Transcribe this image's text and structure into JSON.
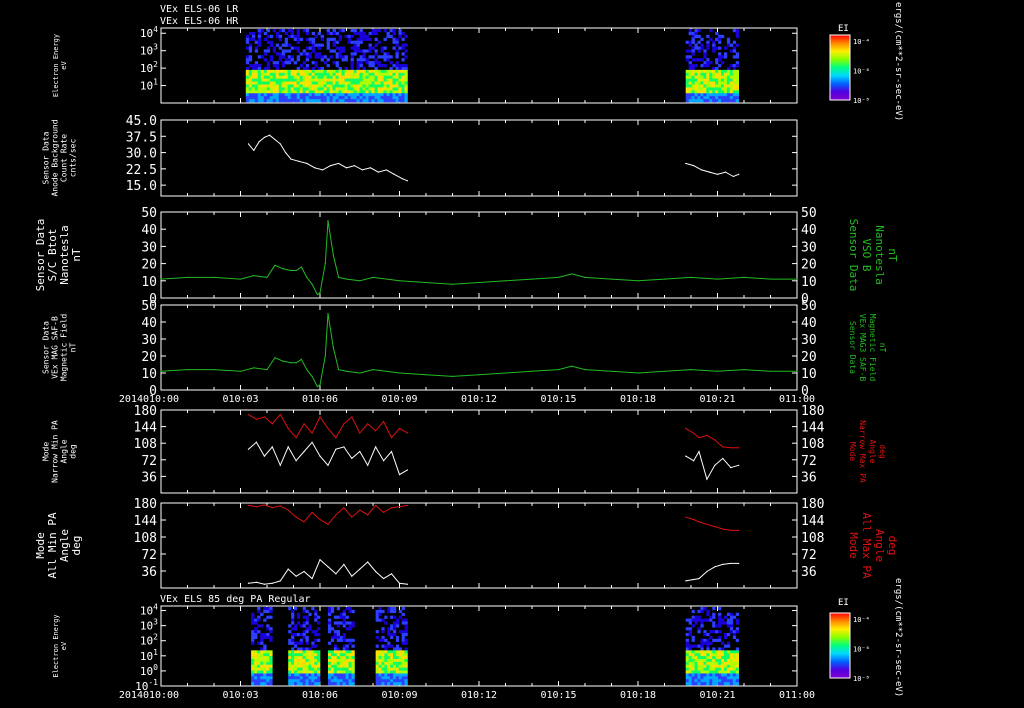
{
  "colors": {
    "background": "#000000",
    "axis": "#ffffff",
    "bfield": "#22bb22",
    "max_pa": "#dd1111",
    "min_pa": "#ffffff"
  },
  "time_axis": {
    "year": "2014",
    "start": "010:00",
    "end": "011:00",
    "ticks": [
      "010:00",
      "010:03",
      "010:06",
      "010:09",
      "010:12",
      "010:15",
      "010:18",
      "010:21",
      "011:00"
    ]
  },
  "chart_data": [
    {
      "type": "heatmap",
      "title": "VEx ELS-06 LR",
      "subtitle": "VEx ELS-06 HR",
      "ylabel": [
        "Electron Energy",
        "eV"
      ],
      "yscale": "log",
      "ylim": [
        1,
        20000
      ],
      "yticks": [
        {
          "v": 10,
          "label": "10",
          "sup": "1"
        },
        {
          "v": 100,
          "label": "10",
          "sup": "2"
        },
        {
          "v": 1000,
          "label": "10",
          "sup": "3"
        },
        {
          "v": 10000,
          "label": "10",
          "sup": "4"
        }
      ],
      "colorbar": {
        "title": "EI",
        "labels": [
          "10⁻⁴",
          "10⁻⁶",
          "10⁻⁸"
        ],
        "unit": "ergs/(cm**2-sr-sec-eV)"
      },
      "data_windows": [
        [
          3.2,
          9.3
        ],
        [
          19.8,
          21.8
        ]
      ]
    },
    {
      "type": "line",
      "ylabel": [
        "Sensor Data",
        "Anode Background",
        "Count Rate",
        "cnts/sec"
      ],
      "ylim": [
        10,
        45
      ],
      "yticks": [
        "15.0",
        "22.5",
        "30.0",
        "37.5",
        "45.0"
      ],
      "ytick_values": [
        15,
        22.5,
        30,
        37.5,
        45
      ],
      "series": [
        {
          "color": "#ffffff",
          "x": [
            3.3,
            3.5,
            3.7,
            3.9,
            4.1,
            4.3,
            4.5,
            4.7,
            4.9,
            5.2,
            5.5,
            5.8,
            6.1,
            6.4,
            6.7,
            7.0,
            7.3,
            7.6,
            7.9,
            8.2,
            8.5,
            8.8,
            9.1,
            9.3
          ],
          "y": [
            34,
            31,
            35,
            37,
            38,
            36,
            34,
            30,
            27,
            26,
            25,
            23,
            22,
            24,
            25,
            23,
            24,
            22,
            23,
            21,
            22,
            20,
            18,
            17
          ]
        },
        {
          "color": "#ffffff",
          "x": [
            19.8,
            20.1,
            20.4,
            20.7,
            21.0,
            21.3,
            21.6,
            21.8
          ],
          "y": [
            25,
            24,
            22,
            21,
            20,
            21,
            19,
            20
          ]
        }
      ]
    },
    {
      "type": "line",
      "ylabel": [
        "Sensor Data",
        "S/C Btot",
        "Nanotesla",
        "nT"
      ],
      "right_label": [
        "Sensor Data",
        "VSO B",
        "Nanotesla",
        "nT"
      ],
      "ylim": [
        0,
        50
      ],
      "yticks": [
        "0",
        "10",
        "20",
        "30",
        "40",
        "50"
      ],
      "ytick_values": [
        0,
        10,
        20,
        30,
        40,
        50
      ],
      "series": [
        {
          "color": "#22bb22",
          "x": [
            0,
            1,
            2,
            3,
            3.5,
            4.0,
            4.3,
            4.6,
            4.9,
            5.1,
            5.3,
            5.5,
            5.7,
            5.9,
            6.0,
            6.2,
            6.3,
            6.5,
            6.7,
            7,
            7.5,
            8,
            9,
            10,
            11,
            12,
            13,
            14,
            15,
            15.5,
            16,
            17,
            18,
            19,
            20,
            21,
            22,
            23,
            24
          ],
          "y": [
            11,
            12,
            12,
            11,
            13,
            12,
            19,
            17,
            16,
            16,
            18,
            12,
            8,
            2,
            3,
            20,
            45,
            25,
            12,
            11,
            10,
            12,
            10,
            9,
            8,
            9,
            10,
            11,
            12,
            14,
            12,
            11,
            10,
            11,
            12,
            11,
            12,
            11,
            11
          ]
        }
      ]
    },
    {
      "type": "line",
      "ylabel": [
        "Sensor Data",
        "VEx MAG SAF-B",
        "Magnetic Field",
        "nT"
      ],
      "right_label": [
        "Sensor Data",
        "VEx MAG3 SAF-B",
        "Magnetic Field",
        "nT"
      ],
      "ylim": [
        0,
        50
      ],
      "yticks": [
        "0",
        "10",
        "20",
        "30",
        "40",
        "50"
      ],
      "ytick_values": [
        0,
        10,
        20,
        30,
        40,
        50
      ],
      "series": [
        {
          "color": "#22bb22",
          "x": [
            0,
            1,
            2,
            3,
            3.5,
            4.0,
            4.3,
            4.6,
            4.9,
            5.1,
            5.3,
            5.5,
            5.7,
            5.9,
            6.0,
            6.2,
            6.3,
            6.5,
            6.7,
            7,
            7.5,
            8,
            9,
            10,
            11,
            12,
            13,
            14,
            15,
            15.5,
            16,
            17,
            18,
            19,
            20,
            21,
            22,
            23,
            24
          ],
          "y": [
            11,
            12,
            12,
            11,
            13,
            12,
            19,
            17,
            16,
            16,
            18,
            12,
            8,
            2,
            3,
            20,
            45,
            25,
            12,
            11,
            10,
            12,
            10,
            9,
            8,
            9,
            10,
            11,
            12,
            14,
            12,
            11,
            10,
            11,
            12,
            11,
            12,
            11,
            11
          ]
        }
      ]
    },
    {
      "type": "line",
      "ylabel": [
        "Mode",
        "Narrow Min PA",
        "Angle",
        "deg"
      ],
      "right_label": [
        "Mode",
        "Narrow Max PA",
        "Angle",
        "deg"
      ],
      "ylim": [
        0,
        180
      ],
      "yticks": [
        "36",
        "72",
        "108",
        "144",
        "180"
      ],
      "ytick_values": [
        36,
        72,
        108,
        144,
        180
      ],
      "series": [
        {
          "color": "#dd1111",
          "x": [
            3.3,
            3.6,
            3.9,
            4.2,
            4.5,
            4.8,
            5.1,
            5.4,
            5.7,
            6.0,
            6.3,
            6.6,
            6.9,
            7.2,
            7.5,
            7.8,
            8.1,
            8.4,
            8.7,
            9.0,
            9.3
          ],
          "y": [
            170,
            160,
            165,
            150,
            170,
            140,
            120,
            150,
            130,
            165,
            140,
            120,
            150,
            165,
            130,
            150,
            135,
            155,
            120,
            140,
            130
          ]
        },
        {
          "color": "#ffffff",
          "x": [
            3.3,
            3.6,
            3.9,
            4.2,
            4.5,
            4.8,
            5.1,
            5.4,
            5.7,
            6.0,
            6.3,
            6.6,
            6.9,
            7.2,
            7.5,
            7.8,
            8.1,
            8.4,
            8.7,
            9.0,
            9.3
          ],
          "y": [
            95,
            110,
            80,
            100,
            60,
            100,
            70,
            90,
            110,
            80,
            60,
            95,
            100,
            75,
            90,
            60,
            100,
            70,
            90,
            40,
            50
          ]
        },
        {
          "color": "#dd1111",
          "x": [
            19.8,
            20.1,
            20.3,
            20.6,
            20.9,
            21.2,
            21.5,
            21.8
          ],
          "y": [
            140,
            130,
            120,
            125,
            115,
            100,
            98,
            98
          ]
        },
        {
          "color": "#ffffff",
          "x": [
            19.8,
            20.1,
            20.3,
            20.6,
            20.9,
            21.2,
            21.5,
            21.8
          ],
          "y": [
            80,
            70,
            90,
            30,
            60,
            75,
            55,
            60
          ]
        }
      ]
    },
    {
      "type": "line",
      "ylabel": [
        "Mode",
        "All Min PA",
        "Angle",
        "deg"
      ],
      "right_label": [
        "Mode",
        "All Max PA",
        "Angle",
        "deg"
      ],
      "ylim": [
        0,
        180
      ],
      "yticks": [
        "36",
        "72",
        "108",
        "144",
        "180"
      ],
      "ytick_values": [
        36,
        72,
        108,
        144,
        180
      ],
      "series": [
        {
          "color": "#dd1111",
          "x": [
            3.3,
            3.6,
            3.9,
            4.2,
            4.5,
            4.8,
            5.1,
            5.4,
            5.7,
            6.0,
            6.3,
            6.6,
            6.9,
            7.2,
            7.5,
            7.8,
            8.1,
            8.4,
            8.7,
            9.0,
            9.3
          ],
          "y": [
            175,
            172,
            176,
            170,
            174,
            165,
            150,
            140,
            160,
            145,
            135,
            155,
            170,
            150,
            165,
            155,
            175,
            160,
            170,
            172,
            175
          ]
        },
        {
          "color": "#ffffff",
          "x": [
            3.3,
            3.6,
            3.9,
            4.2,
            4.5,
            4.8,
            5.1,
            5.4,
            5.7,
            6.0,
            6.3,
            6.6,
            6.9,
            7.2,
            7.5,
            7.8,
            8.1,
            8.4,
            8.7,
            9.0,
            9.3
          ],
          "y": [
            10,
            12,
            8,
            10,
            15,
            40,
            25,
            35,
            20,
            60,
            45,
            30,
            50,
            25,
            40,
            55,
            35,
            20,
            30,
            10,
            8
          ]
        },
        {
          "color": "#dd1111",
          "x": [
            19.8,
            20.1,
            20.3,
            20.6,
            20.9,
            21.2,
            21.5,
            21.8
          ],
          "y": [
            150,
            145,
            140,
            135,
            130,
            125,
            122,
            122
          ]
        },
        {
          "color": "#ffffff",
          "x": [
            19.8,
            20.1,
            20.3,
            20.6,
            20.9,
            21.2,
            21.5,
            21.8
          ],
          "y": [
            15,
            18,
            20,
            35,
            45,
            50,
            52,
            52
          ]
        }
      ]
    },
    {
      "type": "heatmap",
      "title": "VEx ELS 85 deg PA Regular",
      "ylabel": [
        "Electron Energy",
        "eV"
      ],
      "yscale": "log",
      "ylim": [
        0.1,
        20000
      ],
      "yticks": [
        {
          "v": 0.1,
          "label": "10",
          "sup": "-1"
        },
        {
          "v": 1,
          "label": "10",
          "sup": "0"
        },
        {
          "v": 10,
          "label": "10",
          "sup": "1"
        },
        {
          "v": 100,
          "label": "10",
          "sup": "2"
        },
        {
          "v": 1000,
          "label": "10",
          "sup": "3"
        },
        {
          "v": 10000,
          "label": "10",
          "sup": "4"
        }
      ],
      "colorbar": {
        "title": "EI",
        "labels": [
          "10⁻⁴",
          "10⁻⁶",
          "10⁻⁸"
        ],
        "unit": "ergs/(cm**2-sr-sec-eV)"
      },
      "data_windows": [
        [
          3.4,
          4.2
        ],
        [
          4.8,
          6.0
        ],
        [
          6.3,
          7.3
        ],
        [
          8.1,
          9.3
        ],
        [
          19.8,
          21.8
        ]
      ]
    }
  ]
}
